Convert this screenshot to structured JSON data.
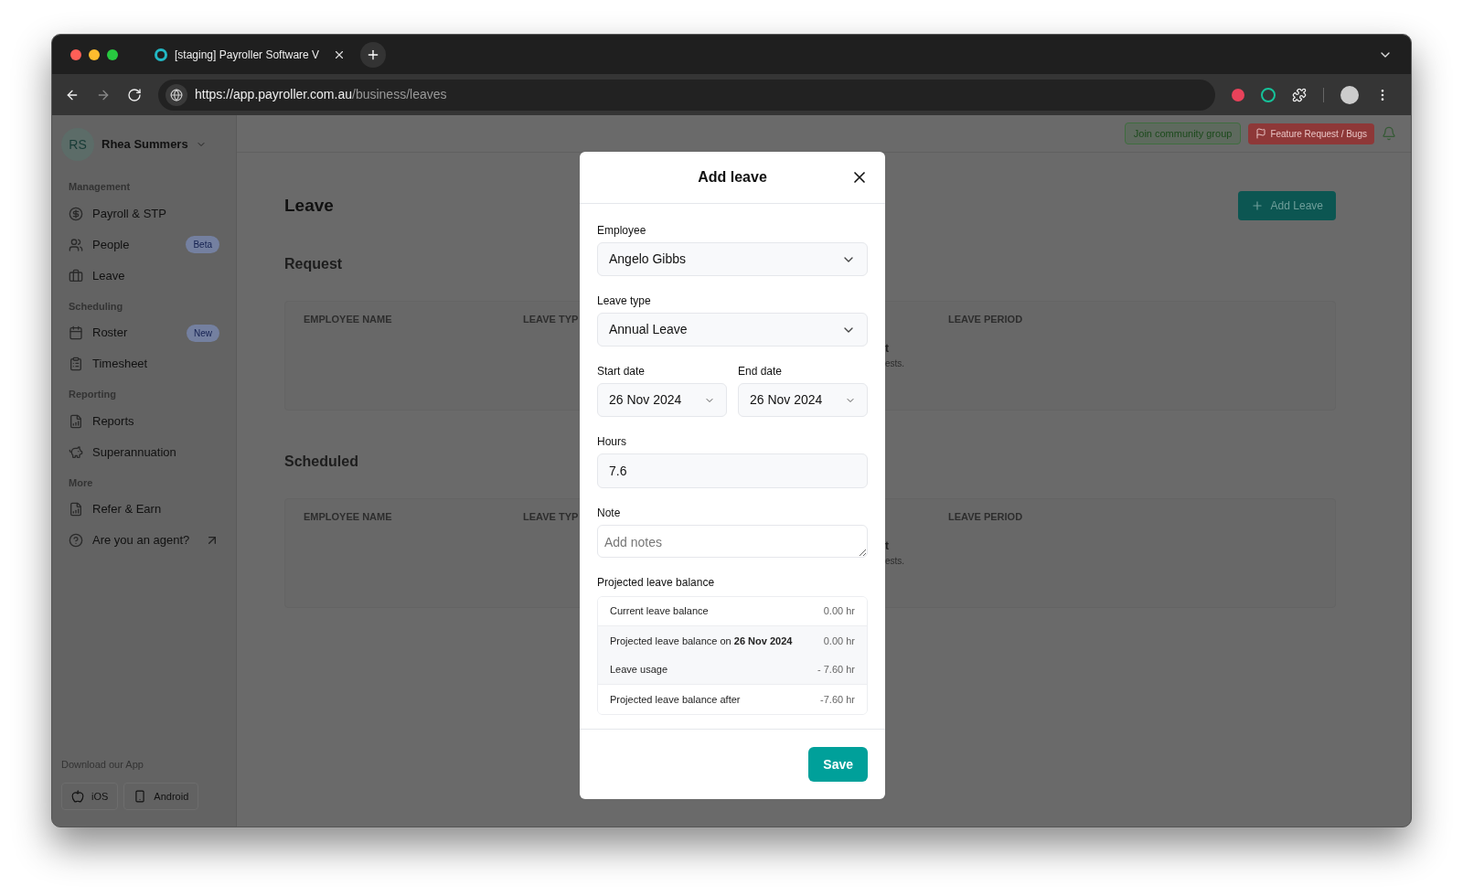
{
  "browser": {
    "tab_title": "[staging] Payroller Software V",
    "url_host": "https://app.payroller.com.au",
    "url_path": "/business/leaves"
  },
  "sidebar": {
    "user": {
      "initials": "RS",
      "name": "Rhea Summers"
    },
    "sections": [
      {
        "title": "Management",
        "items": [
          {
            "label": "Payroll & STP",
            "kind": "link"
          },
          {
            "label": "People",
            "badge": "Beta",
            "kind": "link"
          },
          {
            "label": "Leave",
            "kind": "link"
          }
        ]
      },
      {
        "title": "Scheduling",
        "items": [
          {
            "label": "Roster",
            "badge": "New",
            "kind": "link"
          },
          {
            "label": "Timesheet",
            "kind": "link"
          }
        ]
      },
      {
        "title": "Reporting",
        "items": [
          {
            "label": "Reports",
            "kind": "link"
          },
          {
            "label": "Superannuation",
            "kind": "link"
          }
        ]
      },
      {
        "title": "More",
        "items": [
          {
            "label": "Refer & Earn",
            "kind": "link"
          },
          {
            "label": "Are you an agent?",
            "kind": "external"
          }
        ]
      }
    ],
    "download": {
      "title": "Download our App",
      "buttons": [
        {
          "label": "iOS"
        },
        {
          "label": "Android"
        }
      ]
    }
  },
  "topbar": {
    "community": "Join community group",
    "feature": "Feature Request / Bugs"
  },
  "page": {
    "title": "Leave",
    "add_button": "Add Leave",
    "sections": [
      {
        "title": "Request",
        "columns": [
          "EMPLOYEE NAME",
          "LEAVE TYP",
          "LEAVE PERIOD"
        ],
        "empty_fragments": [
          "t",
          "ests."
        ]
      },
      {
        "title": "Scheduled",
        "columns": [
          "EMPLOYEE NAME",
          "LEAVE TYP",
          "LEAVE PERIOD"
        ],
        "empty_fragments": [
          "t",
          "ests."
        ]
      }
    ]
  },
  "modal": {
    "title": "Add leave",
    "employee": {
      "label": "Employee",
      "value": "Angelo Gibbs"
    },
    "leave_type": {
      "label": "Leave type",
      "value": "Annual Leave"
    },
    "start_date": {
      "label": "Start date",
      "value": "26 Nov 2024"
    },
    "end_date": {
      "label": "End date",
      "value": "26 Nov 2024"
    },
    "hours": {
      "label": "Hours",
      "value": "7.6"
    },
    "note": {
      "label": "Note",
      "placeholder": "Add notes"
    },
    "balance": {
      "title": "Projected leave balance",
      "rows": [
        {
          "label": "Current leave balance",
          "value": "0.00 hr"
        },
        {
          "label": "Projected leave balance on **26 Nov 2024**",
          "value": "0.00 hr"
        },
        {
          "label": "Leave usage",
          "value": "- 7.60 hr"
        },
        {
          "label": "Projected leave balance after",
          "value": "-7.60 hr"
        }
      ]
    },
    "save": "Save"
  }
}
